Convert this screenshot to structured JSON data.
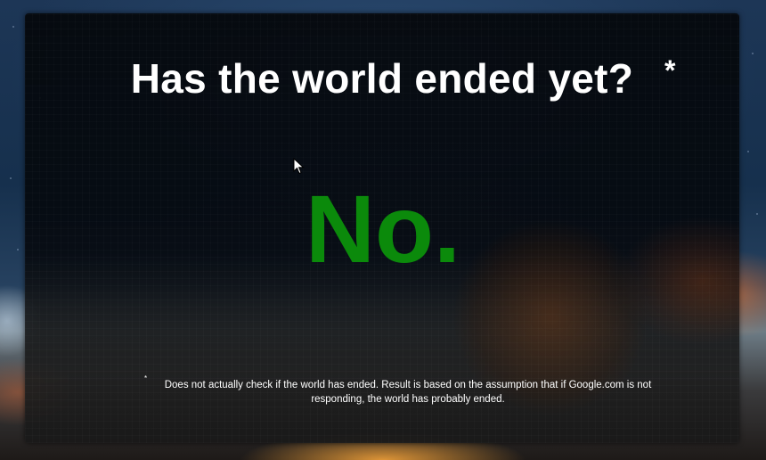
{
  "page": {
    "title": "Has the world ended yet?",
    "title_mark": "*",
    "answer": "No.",
    "answer_color": "#0b8a0b",
    "footnote_mark": "*",
    "footnote": "Does not actually check if the world has ended. Result is based on the assumption that if Google.com is not responding, the world has probably ended."
  },
  "icons": {
    "cursor": "mouse-pointer-icon"
  }
}
